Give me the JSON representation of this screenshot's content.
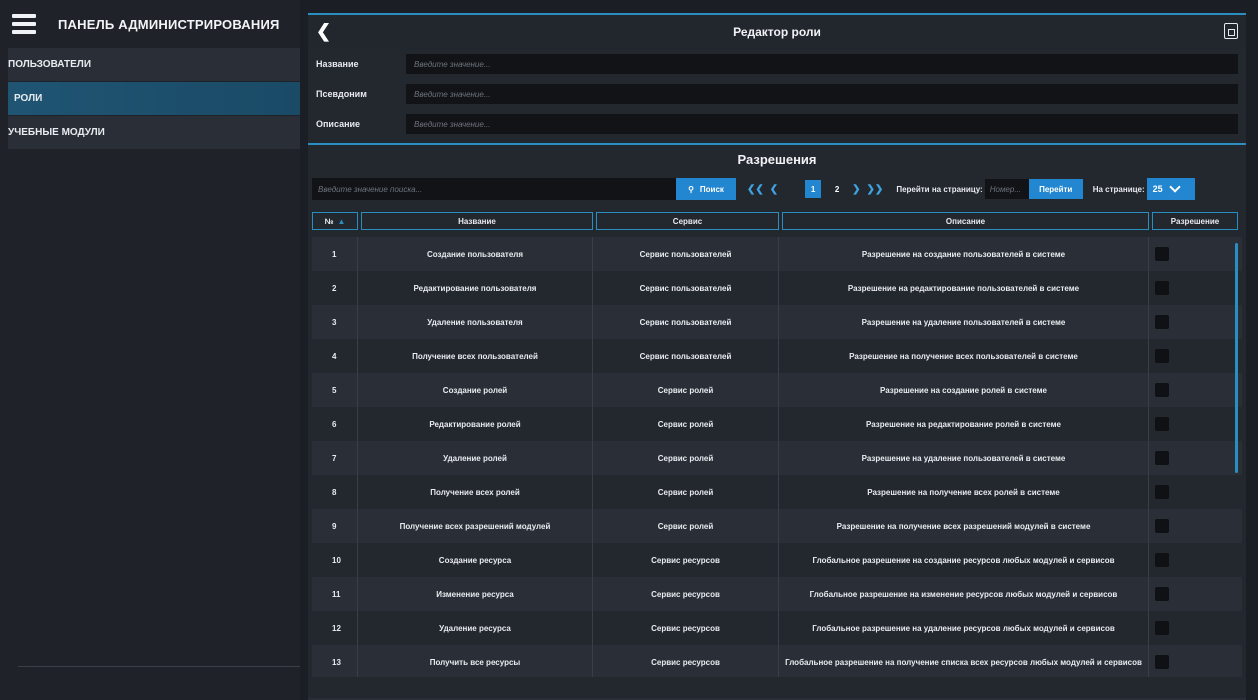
{
  "sidebar": {
    "title": "ПАНЕЛЬ АДМИНИСТРИРОВАНИЯ",
    "items": [
      {
        "label": "ПОЛЬЗОВАТЕЛИ"
      },
      {
        "label": "РОЛИ"
      },
      {
        "label": "УЧЕБНЫЕ МОДУЛИ"
      }
    ]
  },
  "header": {
    "title": "Редактор роли"
  },
  "form": {
    "fields": [
      {
        "label": "Название",
        "placeholder": "Введите значение..."
      },
      {
        "label": "Псевдоним",
        "placeholder": "Введите значение..."
      },
      {
        "label": "Описание",
        "placeholder": "Введите значение..."
      }
    ]
  },
  "permissions": {
    "title": "Разрешения",
    "search_placeholder": "Введите значение поиска...",
    "search_button": "Поиск",
    "pages": [
      "1",
      "2"
    ],
    "goto_label": "Перейти на страницу:",
    "goto_placeholder": "Номер...",
    "goto_button": "Перейти",
    "per_page_label": "На странице:",
    "per_page_value": "25",
    "columns": [
      "№",
      "Название",
      "Сервис",
      "Описание",
      "Разрешение"
    ],
    "rows": [
      {
        "num": "1",
        "name": "Создание пользователя",
        "service": "Сервис пользователей",
        "desc": "Разрешение на создание пользователей в системе"
      },
      {
        "num": "2",
        "name": "Редактирование пользователя",
        "service": "Сервис пользователей",
        "desc": "Разрешение на редактирование пользователей в системе"
      },
      {
        "num": "3",
        "name": "Удаление пользователя",
        "service": "Сервис пользователей",
        "desc": "Разрешение на удаление пользователей в системе"
      },
      {
        "num": "4",
        "name": "Получение всех пользователей",
        "service": "Сервис пользователей",
        "desc": "Разрешение на получение всех пользователей в системе"
      },
      {
        "num": "5",
        "name": "Создание ролей",
        "service": "Сервис ролей",
        "desc": "Разрешение на создание ролей в системе"
      },
      {
        "num": "6",
        "name": "Редактирование ролей",
        "service": "Сервис ролей",
        "desc": "Разрешение на редактирование ролей в системе"
      },
      {
        "num": "7",
        "name": "Удаление ролей",
        "service": "Сервис ролей",
        "desc": "Разрешение на удаление пользователей в системе"
      },
      {
        "num": "8",
        "name": "Получение всех ролей",
        "service": "Сервис ролей",
        "desc": "Разрешение на получение всех ролей в системе"
      },
      {
        "num": "9",
        "name": "Получение всех разрешений модулей",
        "service": "Сервис ролей",
        "desc": "Разрешение на получение всех разрешений модулей в системе"
      },
      {
        "num": "10",
        "name": "Создание ресурса",
        "service": "Сервис ресурсов",
        "desc": "Глобальное разрешение на создание ресурсов любых модулей и сервисов"
      },
      {
        "num": "11",
        "name": "Изменение ресурса",
        "service": "Сервис ресурсов",
        "desc": "Глобальное разрешение на изменение ресурсов любых модулей и сервисов"
      },
      {
        "num": "12",
        "name": "Удаление ресурса",
        "service": "Сервис ресурсов",
        "desc": "Глобальное разрешение на удаление ресурсов любых модулей и сервисов"
      },
      {
        "num": "13",
        "name": "Получить все ресурсы",
        "service": "Сервис ресурсов",
        "desc": "Глобальное разрешение на получение списка всех ресурсов любых модулей и сервисов"
      }
    ]
  }
}
